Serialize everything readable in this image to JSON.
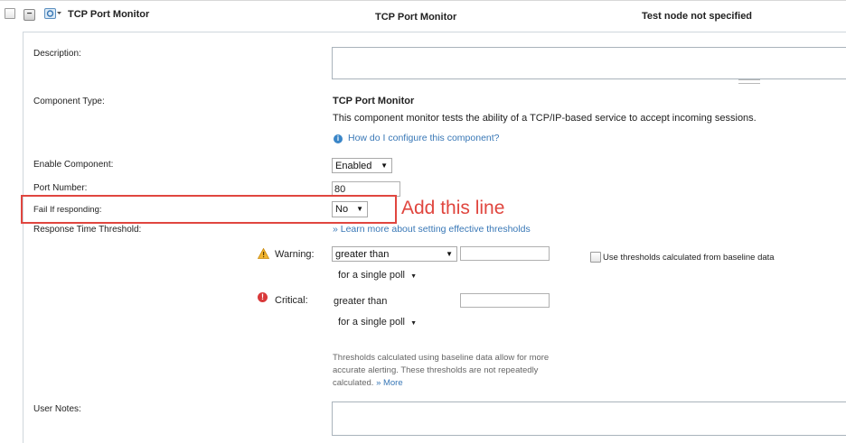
{
  "header": {
    "title": "TCP Port Monitor",
    "col_type": "TCP Port Monitor",
    "col_status": "Test node not specified"
  },
  "form": {
    "description_label": "Description:",
    "component_type_label": "Component Type:",
    "component_type_value": "TCP Port Monitor",
    "component_description": "This component monitor tests the ability of a TCP/IP-based service to accept incoming sessions.",
    "help_link": "How do I configure this component?",
    "enable_label": "Enable Component:",
    "enable_value": "Enabled",
    "port_label": "Port Number:",
    "port_value": "80",
    "fail_label": "Fail If responding:",
    "fail_value": "No",
    "response_label": "Response Time Threshold:",
    "learn_more_link": "» Learn more about setting effective thresholds",
    "warning": {
      "label": "Warning:",
      "operator": "greater than",
      "poll": "for a single poll"
    },
    "critical": {
      "label": "Critical:",
      "operator": "greater than",
      "poll": "for a single poll"
    },
    "baseline_checkbox": "Use thresholds calculated from baseline data",
    "baseline_note": "Thresholds calculated using baseline data allow for more accurate alerting. These thresholds are not repeatedly calculated.",
    "more_link": "» More",
    "user_notes_label": "User Notes:"
  },
  "annotation": {
    "text": "Add this line"
  },
  "colors": {
    "annotation": "#e0463f",
    "link": "#3877b6"
  }
}
